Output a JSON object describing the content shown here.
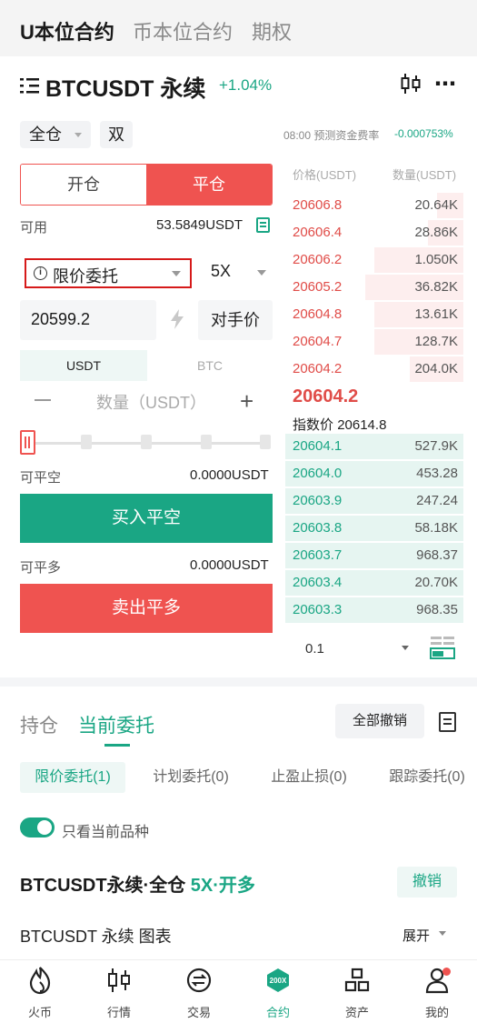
{
  "top_tabs": [
    "U本位合约",
    "币本位合约",
    "期权"
  ],
  "symbol": {
    "name": "BTCUSDT 永续",
    "change": "+1.04%"
  },
  "margin_mode": "全仓",
  "position_mode": "双",
  "funding": {
    "label": "08:00 预测资金费率",
    "value": "-0.000753%"
  },
  "side_tabs": {
    "open": "开仓",
    "close": "平仓"
  },
  "available": {
    "label": "可用",
    "value": "53.5849USDT"
  },
  "order_type": "限价委托",
  "leverage": "5X",
  "price_input": "20599.2",
  "counterparty_btn": "对手价",
  "units": {
    "usdt": "USDT",
    "btc": "BTC"
  },
  "qty_placeholder": "数量（USDT）",
  "slider_percent": 0,
  "close_short": {
    "label": "可平空",
    "value": "0.0000USDT",
    "button": "买入平空"
  },
  "close_long": {
    "label": "可平多",
    "value": "0.0000USDT",
    "button": "卖出平多"
  },
  "orderbook": {
    "price_header": "价格(USDT)",
    "qty_header": "数量(USDT)",
    "asks": [
      {
        "price": "20606.8",
        "qty": "20.64K",
        "depth": 0.15
      },
      {
        "price": "20606.4",
        "qty": "28.86K",
        "depth": 0.2
      },
      {
        "price": "20606.2",
        "qty": "1.050K",
        "depth": 0.5
      },
      {
        "price": "20605.2",
        "qty": "36.82K",
        "depth": 0.55
      },
      {
        "price": "20604.8",
        "qty": "13.61K",
        "depth": 0.5
      },
      {
        "price": "20604.7",
        "qty": "128.7K",
        "depth": 0.5
      },
      {
        "price": "20604.2",
        "qty": "204.0K",
        "depth": 0.3
      }
    ],
    "last_price": "20604.2",
    "index_label": "指数价",
    "index_price": "20614.8",
    "bids": [
      {
        "price": "20604.1",
        "qty": "527.9K",
        "depth": 1.0
      },
      {
        "price": "20604.0",
        "qty": "453.28",
        "depth": 1.0
      },
      {
        "price": "20603.9",
        "qty": "247.24",
        "depth": 1.0
      },
      {
        "price": "20603.8",
        "qty": "58.18K",
        "depth": 1.0
      },
      {
        "price": "20603.7",
        "qty": "968.37",
        "depth": 1.0
      },
      {
        "price": "20603.4",
        "qty": "20.70K",
        "depth": 1.0
      },
      {
        "price": "20603.3",
        "qty": "968.35",
        "depth": 1.0
      }
    ],
    "depth_step": "0.1"
  },
  "orders_tabs": {
    "positions": "持仓",
    "current": "当前委托"
  },
  "cancel_all": "全部撤销",
  "filters": [
    "限价委托(1)",
    "计划委托(0)",
    "止盈止损(0)",
    "跟踪委托(0)"
  ],
  "only_current": "只看当前品种",
  "order": {
    "title_main": "BTCUSDT永续·全仓 ",
    "title_accent": "5X·开多",
    "revoke": "撤销"
  },
  "chart_row": {
    "title": "BTCUSDT 永续 图表",
    "expand": "展开"
  },
  "nav": [
    "火币",
    "行情",
    "交易",
    "合约",
    "资产",
    "我的"
  ],
  "colors": {
    "green": "#1aa684",
    "red": "#ef5350"
  }
}
